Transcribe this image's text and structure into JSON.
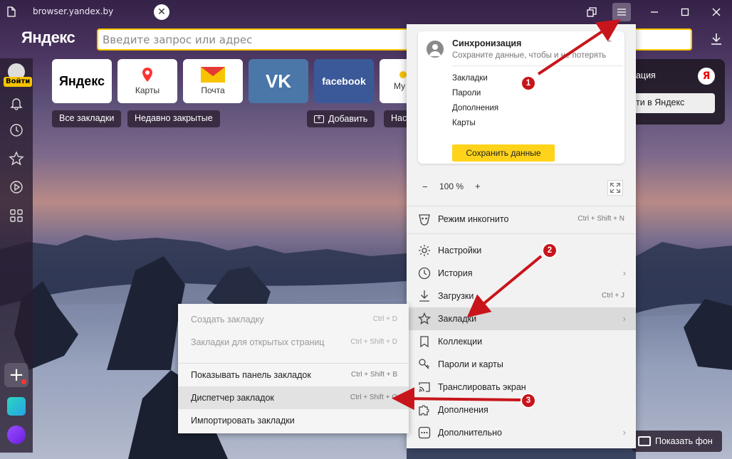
{
  "window": {
    "tab_title": "browser.yandex.by"
  },
  "address_bar": {
    "logo": "Яндекс",
    "placeholder": "Введите запрос или адрес"
  },
  "sidebar": {
    "login_label": "Войти"
  },
  "tiles": [
    {
      "label": "Яндекс"
    },
    {
      "label": "Карты"
    },
    {
      "label": "Почта"
    },
    {
      "label": ""
    },
    {
      "label": "facebook"
    },
    {
      "label": "Му"
    }
  ],
  "bookmark_chips": {
    "all_bookmarks": "Все закладки",
    "recently_closed": "Недавно закрытые",
    "add": "Добавить",
    "settings_partial": "Нас"
  },
  "widget": {
    "title_partial": "рация",
    "login_button": "йти в Яндекс",
    "ya_letter": "Я"
  },
  "show_background": "Показать фон",
  "menu": {
    "sync": {
      "title": "Синхронизация",
      "subtitle": "Сохраните данные, чтобы и не потерять",
      "items": [
        "Закладки",
        "Пароли",
        "Дополнения",
        "Карты"
      ],
      "save_button": "Сохранить данные"
    },
    "zoom": {
      "minus": "−",
      "value": "100 %",
      "plus": "+"
    },
    "incognito": {
      "label": "Режим инкогнито",
      "shortcut": "Ctrl + Shift + N"
    },
    "items": [
      {
        "label": "Настройки",
        "shortcut": ""
      },
      {
        "label": "История",
        "shortcut": ""
      },
      {
        "label": "Загрузки",
        "shortcut": "Ctrl + J"
      },
      {
        "label": "Закладки",
        "shortcut": ""
      },
      {
        "label": "Коллекции",
        "shortcut": ""
      },
      {
        "label": "Пароли и карты",
        "shortcut": ""
      },
      {
        "label": "Транслировать экран",
        "shortcut": ""
      },
      {
        "label": "Дополнения",
        "shortcut": ""
      },
      {
        "label": "Дополнительно",
        "shortcut": ""
      }
    ]
  },
  "bookmarks_submenu": {
    "items": [
      {
        "label": "Создать закладку",
        "shortcut": "Ctrl + D"
      },
      {
        "label": "Закладки для открытых страниц",
        "shortcut": "Ctrl + Shift + D"
      },
      {
        "label": "Показывать панель закладок",
        "shortcut": "Ctrl + Shift + B"
      },
      {
        "label": "Диспетчер закладок",
        "shortcut": "Ctrl + Shift + O"
      },
      {
        "label": "Импортировать закладки",
        "shortcut": ""
      }
    ]
  },
  "annotations": {
    "step1": "1",
    "step2": "2",
    "step3": "3"
  },
  "colors": {
    "accent_yellow": "#ffd31a",
    "annotation_red": "#c8151b",
    "address_border": "#f7c400"
  }
}
